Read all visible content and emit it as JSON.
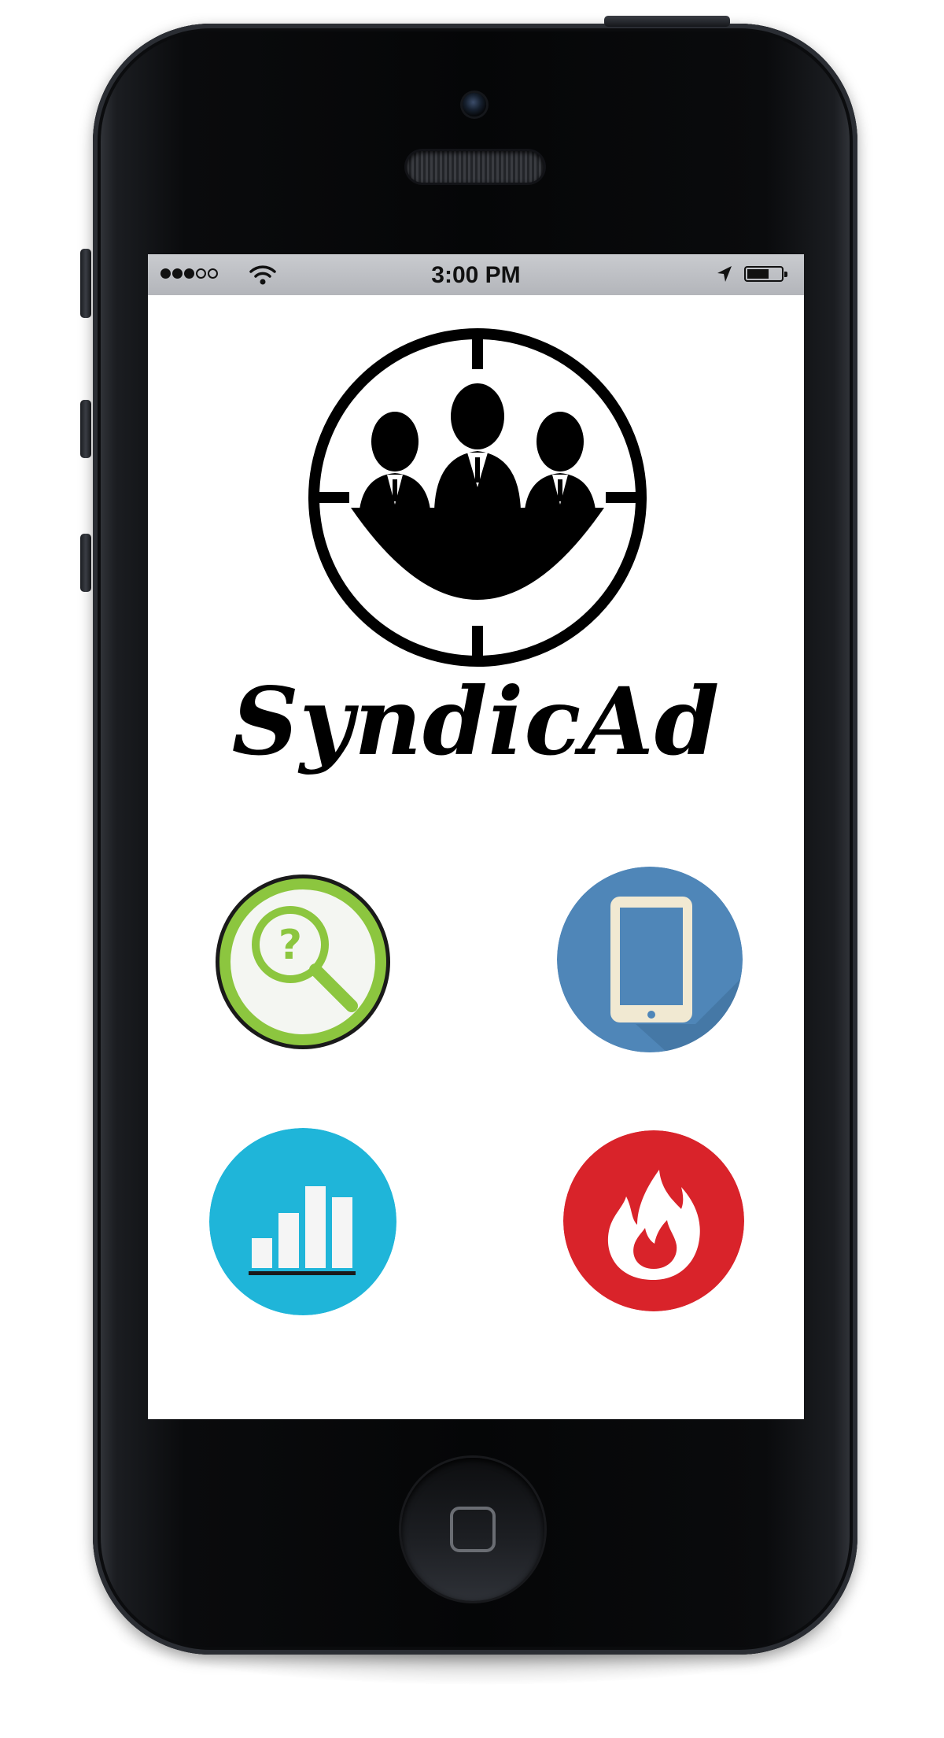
{
  "statusbar": {
    "time": "3:00 PM",
    "signal_bars": 3,
    "signal_total": 5,
    "battery_level": 0.65
  },
  "app": {
    "name": "SyndicAd"
  },
  "icons": [
    {
      "name": "search-question-icon",
      "color": "#8cc63f"
    },
    {
      "name": "tablet-icon",
      "color": "#4f86b8"
    },
    {
      "name": "bar-chart-icon",
      "color": "#1fb5d9"
    },
    {
      "name": "fire-icon",
      "color": "#d9232a"
    }
  ],
  "colors": {
    "phone_body": "#050607",
    "statusbar": "#bfc1c5",
    "logo": "#000000"
  }
}
